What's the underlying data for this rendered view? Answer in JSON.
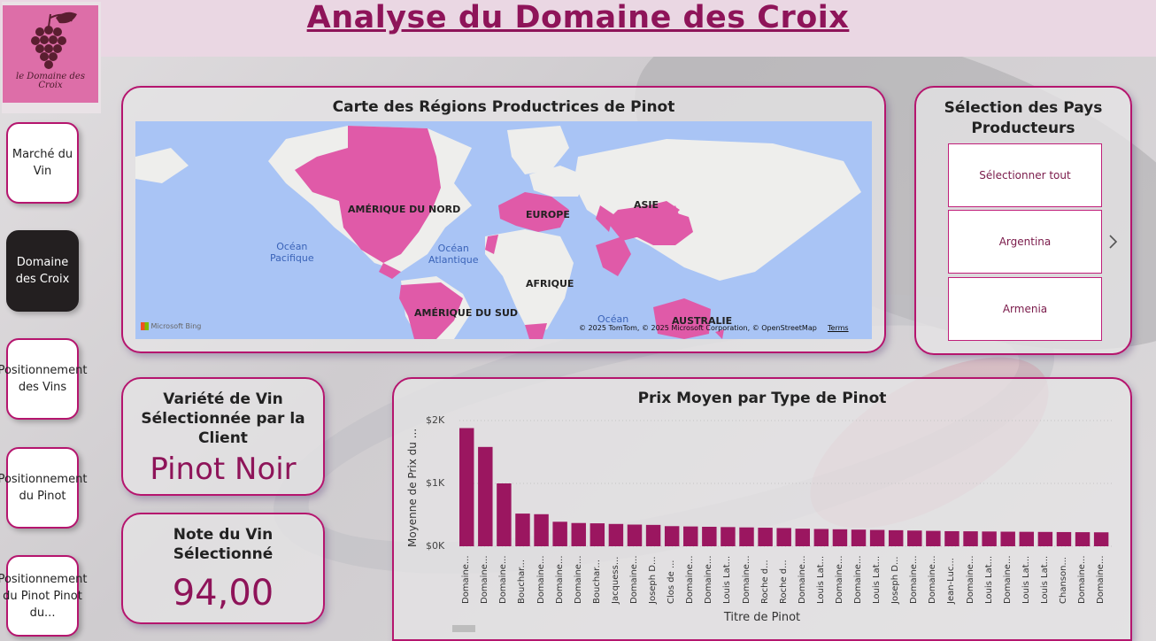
{
  "header": {
    "title": "Analyse du Domaine des Croix"
  },
  "logo": {
    "text_line1": "le Domaine des",
    "text_line2": "Croix"
  },
  "nav": [
    {
      "label": "Marché du Vin",
      "active": false
    },
    {
      "label": "Domaine des Croix",
      "active": true
    },
    {
      "label": "Positionnement des Vins",
      "active": false
    },
    {
      "label": "Positionnement du Pinot",
      "active": false
    },
    {
      "label": "Positionnement du Pinot Pinot du...",
      "active": false
    }
  ],
  "map_card": {
    "title": "Carte des Régions Productrices de Pinot",
    "labels": {
      "north_america": "AMÉRIQUE DU NORD",
      "europe": "EUROPE",
      "asia": "ASIE",
      "africa": "AFRIQUE",
      "south_america": "AMÉRIQUE DU SUD",
      "australia": "AUSTRALIE"
    },
    "oceans": {
      "pacific": "Océan\nPacifique",
      "atlantic": "Océan\nAtlantique",
      "indian": "Océan"
    },
    "bing": "Microsoft Bing",
    "attribution": "© 2025 TomTom, © 2025 Microsoft Corporation, © OpenStreetMap",
    "terms": "Terms",
    "highlight_color": "#e05aa8",
    "water_color": "#a9c4f5",
    "land_color": "#eeeeec"
  },
  "slicer_card": {
    "title": "Sélection des Pays Producteurs",
    "items": [
      "Sélectionner tout",
      "Argentina",
      "Armenia"
    ],
    "next_icon": "chevron-right-icon"
  },
  "variety_card": {
    "title": "Variété de Vin Sélectionnée par la Client",
    "value": "Pinot Noir"
  },
  "note_card": {
    "title": "Note du Vin Sélectionné",
    "value": "94,00"
  },
  "chart_data": {
    "type": "bar",
    "title": "Prix Moyen par Type de Pinot",
    "xlabel": "Titre de Pinot",
    "ylabel": "Moyenne de Prix du ...",
    "yticks": [
      "$2K",
      "$1K",
      "$0K"
    ],
    "ylim": [
      0,
      2000
    ],
    "bar_color": "#9b1660",
    "categories": [
      "Domaine...",
      "Domaine...",
      "Domaine...",
      "Bouchar...",
      "Domaine...",
      "Domaine...",
      "Domaine...",
      "Bouchar...",
      "Jacquess...",
      "Domaine...",
      "Joseph D...",
      "Clos de ...",
      "Domaine...",
      "Domaine...",
      "Louis Lat...",
      "Domaine...",
      "Roche d...",
      "Roche d...",
      "Domaine...",
      "Louis Lat...",
      "Domaine...",
      "Domaine...",
      "Louis Lat...",
      "Joseph D...",
      "Domaine...",
      "Domaine...",
      "Jean-Luc...",
      "Domaine...",
      "Louis Lat...",
      "Domaine...",
      "Louis Lat...",
      "Louis Lat...",
      "Chanson...",
      "Domaine...",
      "Domaine..."
    ],
    "values": [
      1880,
      1580,
      1000,
      520,
      510,
      390,
      370,
      365,
      355,
      345,
      340,
      320,
      315,
      310,
      305,
      300,
      295,
      290,
      280,
      275,
      270,
      265,
      260,
      255,
      250,
      245,
      240,
      238,
      235,
      232,
      230,
      228,
      226,
      224,
      222
    ]
  }
}
